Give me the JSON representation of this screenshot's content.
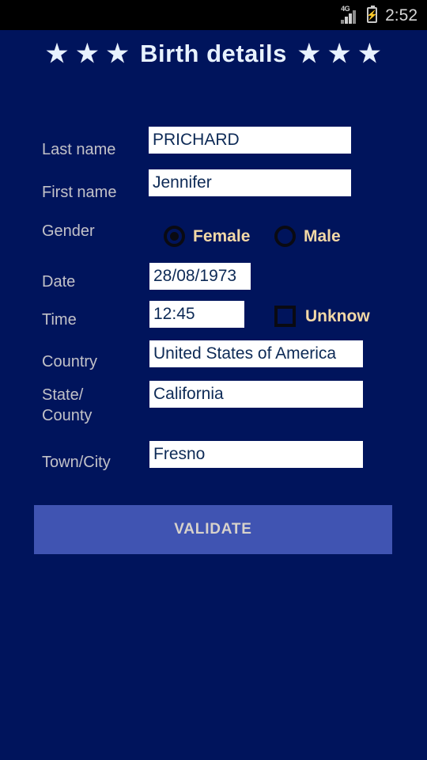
{
  "status_bar": {
    "network_label": "4G",
    "time": "2:52",
    "battery_icon": "battery-charging-icon",
    "signal_icon": "signal-bars-icon"
  },
  "header": {
    "title": "Birth details",
    "star_left": [
      "★",
      "★",
      "★"
    ],
    "star_right": [
      "★",
      "★",
      "★"
    ]
  },
  "form": {
    "last_name": {
      "label": "Last name",
      "value": "PRICHARD"
    },
    "first_name": {
      "label": "First name",
      "value": "Jennifer"
    },
    "gender": {
      "label": "Gender",
      "options": [
        {
          "label": "Female",
          "selected": true
        },
        {
          "label": "Male",
          "selected": false
        }
      ]
    },
    "date": {
      "label": "Date",
      "value": "28/08/1973"
    },
    "time": {
      "label": "Time",
      "value": "12:45"
    },
    "time_unknown": {
      "label": "Unknow",
      "checked": false
    },
    "country": {
      "label": "Country",
      "value": "United States of America"
    },
    "state_county": {
      "label": "State/\nCounty",
      "label_line1": "State/",
      "label_line2": "County",
      "value": "California"
    },
    "town_city": {
      "label": "Town/City",
      "value": "Fresno"
    }
  },
  "actions": {
    "validate_label": "VALIDATE"
  },
  "colors": {
    "background": "#00145c",
    "field_background": "#ffffff",
    "field_text": "#0d2a56",
    "label_text": "#c2c2c8",
    "accent_text": "#f3d8a6",
    "title_text": "#e8f2ff",
    "button_background": "#4054b2",
    "button_text": "#d7d2cb",
    "status_bar_background": "#000000"
  }
}
